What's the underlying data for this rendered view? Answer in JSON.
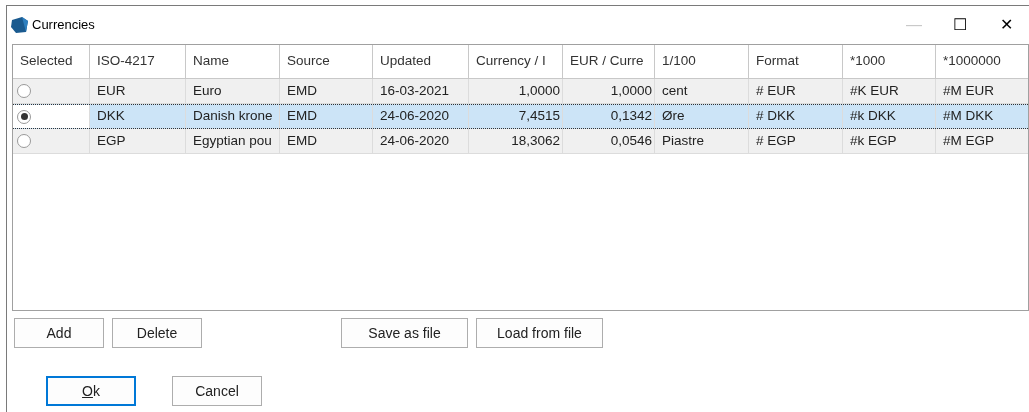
{
  "window": {
    "title": "Currencies",
    "controls": [
      "—",
      "☐",
      "✕"
    ]
  },
  "table": {
    "columns": [
      "Selected",
      "ISO-4217",
      "Name",
      "Source",
      "Updated",
      "Currency / I",
      "EUR / Curre",
      "1/100",
      "Format",
      "*1000",
      "*1000000"
    ],
    "rows": [
      {
        "selected": false,
        "cells": [
          "",
          "EUR",
          "Euro",
          "EMD",
          "16-03-2021",
          "1,0000",
          "1,0000",
          "cent",
          "# EUR",
          "#K EUR",
          "#M EUR"
        ]
      },
      {
        "selected": true,
        "cells": [
          "",
          "DKK",
          "Danish krone",
          "EMD",
          "24-06-2020",
          "7,4515",
          "0,1342",
          "Øre",
          "# DKK",
          "#k DKK",
          "#M DKK"
        ]
      },
      {
        "selected": false,
        "cells": [
          "",
          "EGP",
          "Egyptian pou",
          "EMD",
          "24-06-2020",
          "18,3062",
          "0,0546",
          "Piastre",
          "# EGP",
          "#k EGP",
          "#M EGP"
        ]
      }
    ]
  },
  "table_buttons": [
    "Add",
    "Delete",
    "Save as file",
    "Load from file"
  ],
  "dialog_buttons": [
    {
      "label": "Ok",
      "default": true
    },
    {
      "label": "Cancel",
      "default": false
    }
  ]
}
